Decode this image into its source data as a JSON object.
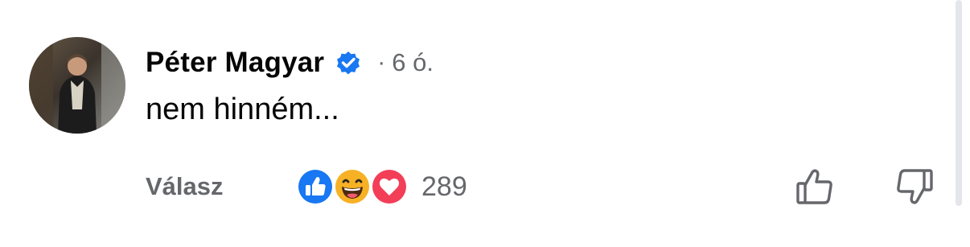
{
  "comment": {
    "author": "Péter Magyar",
    "verified": true,
    "separator": "·",
    "time": "6 ó.",
    "text": "nem hinném...",
    "reply_label": "Válasz",
    "reactions": {
      "icons": [
        "like-icon",
        "haha-icon",
        "love-icon"
      ],
      "count": "289"
    },
    "actions": {
      "upvote_icon": "thumbs-up-outline-icon",
      "downvote_icon": "thumbs-down-outline-icon"
    }
  },
  "colors": {
    "text_primary": "#050505",
    "text_secondary": "#65676b",
    "verified_blue": "#1877f2",
    "like_blue": "#1877f2",
    "love_red": "#f33e58",
    "haha_yellow": "#f7b125"
  }
}
